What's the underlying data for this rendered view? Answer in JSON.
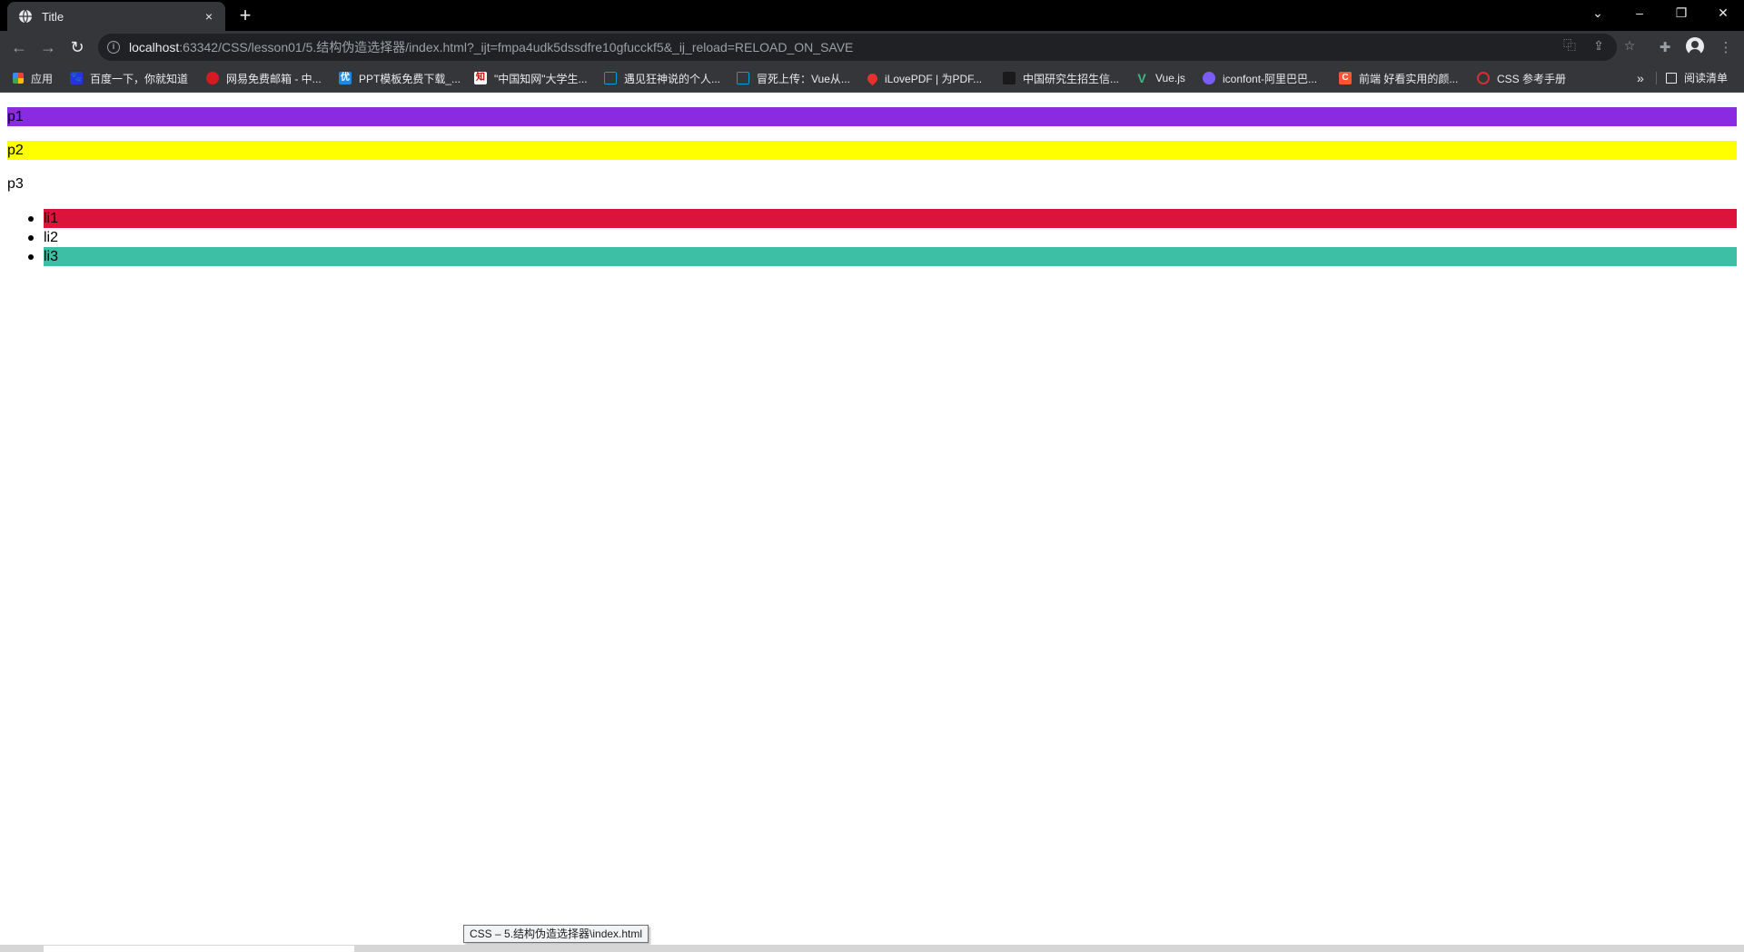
{
  "browser": {
    "tab_title": "Title",
    "tab_close": "×",
    "new_tab": "+",
    "window_controls": {
      "tabs_menu": "⌄",
      "minimize": "–",
      "restore": "❐",
      "close": "✕"
    }
  },
  "toolbar": {
    "back": "←",
    "forward": "→",
    "reload": "↻",
    "url_host": "localhost",
    "url_rest": ":63342/CSS/lesson01/5.结构伪造选择器/index.html?_ijt=fmpa4udk5dssdfre10gfucckf5&_ij_reload=RELOAD_ON_SAVE",
    "translate": "⿻",
    "share": "⇪",
    "bookmark_star": "☆",
    "extensions": "✚",
    "menu": "⋮"
  },
  "bookmarks": {
    "items": [
      {
        "label": "应用",
        "icon": "apps-icon",
        "color": "#e8453c"
      },
      {
        "label": "百度一下，你就知道",
        "icon": "baidu-icon",
        "color": "#2932e1"
      },
      {
        "label": "网易免费邮箱 - 中...",
        "icon": "netease-icon",
        "color": "#d71921"
      },
      {
        "label": "PPT模板免费下载_...",
        "icon": "ppt-icon",
        "color": "#1e88e5"
      },
      {
        "label": "\"中国知网\"大学生...",
        "icon": "cnki-icon",
        "color": "#ffffff"
      },
      {
        "label": "遇见狂神说的个人...",
        "icon": "bilibili-icon",
        "color": "#00a1d6"
      },
      {
        "label": "冒死上传：Vue从...",
        "icon": "bilibili-icon",
        "color": "#00a1d6"
      },
      {
        "label": "iLovePDF | 为PDF...",
        "icon": "ilovepdf-icon",
        "color": "#e5322d"
      },
      {
        "label": "中国研究生招生信...",
        "icon": "chsi-icon",
        "color": "#1a1a1a"
      },
      {
        "label": "Vue.js",
        "icon": "vue-icon",
        "color": "#41b883"
      },
      {
        "label": "iconfont-阿里巴巴...",
        "icon": "iconfont-icon",
        "color": "#7b5cf5"
      },
      {
        "label": "前端 好看实用的颜...",
        "icon": "csdn-icon",
        "color": "#fc5531"
      },
      {
        "label": "CSS 参考手册",
        "icon": "runoob-icon",
        "color": "#d32f2f"
      }
    ],
    "overflow": "»",
    "reading_list": "阅读清单"
  },
  "page": {
    "paragraphs": [
      {
        "text": "p1",
        "bg": "#8a2be2"
      },
      {
        "text": "p2",
        "bg": "#ffff00"
      },
      {
        "text": "p3",
        "bg": "transparent"
      }
    ],
    "list": [
      {
        "text": "li1",
        "bg": "#dc143c"
      },
      {
        "text": "li2",
        "bg": "transparent"
      },
      {
        "text": "li3",
        "bg": "#3cbfa4"
      }
    ]
  },
  "status": {
    "text": "CSS – 5.结构伪造选择器\\index.html"
  }
}
